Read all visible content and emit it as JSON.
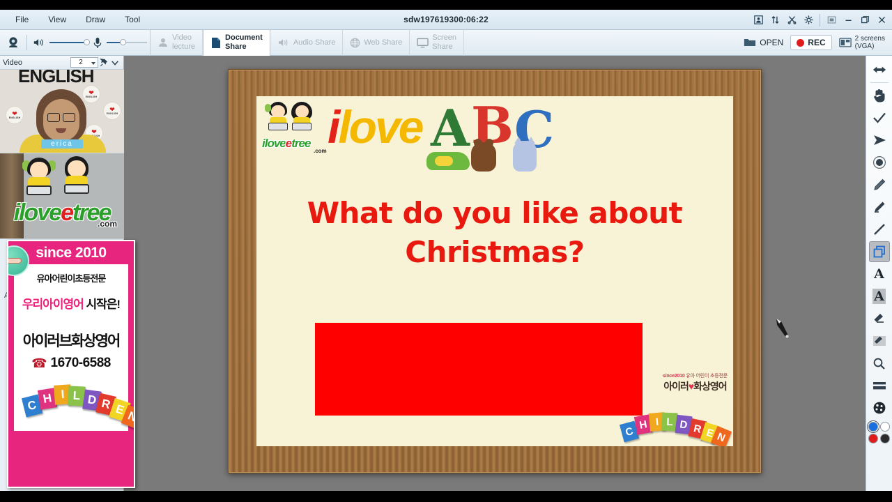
{
  "window": {
    "title": "sdw197619300:06:22",
    "menu": [
      "File",
      "View",
      "Draw",
      "Tool"
    ],
    "title_buttons": [
      {
        "name": "user-list-icon",
        "glyph": "☰"
      },
      {
        "name": "sort-arrows-icon",
        "glyph": "⇅"
      },
      {
        "name": "scissors-icon",
        "glyph": "✂"
      },
      {
        "name": "gear-icon",
        "glyph": "⚙"
      },
      {
        "name": "fullscreen-icon",
        "glyph": "▣"
      },
      {
        "name": "minimize-icon",
        "glyph": "–"
      },
      {
        "name": "maximize-icon",
        "glyph": "❐"
      },
      {
        "name": "close-icon",
        "glyph": "✕"
      }
    ]
  },
  "toolbar": {
    "speaker_level": 100,
    "mic_level": 40,
    "tabs": [
      {
        "label_line1": "Video",
        "label_line2": "lecture",
        "active": false,
        "icon": "person-video-icon"
      },
      {
        "label_line1": "Document",
        "label_line2": "Share",
        "active": true,
        "icon": "document-icon"
      },
      {
        "label_line1": "Audio Share",
        "label_line2": "",
        "active": false,
        "icon": "speaker-icon"
      },
      {
        "label_line1": "Web Share",
        "label_line2": "",
        "active": false,
        "icon": "globe-icon"
      },
      {
        "label_line1": "Screen",
        "label_line2": "Share",
        "active": false,
        "icon": "monitor-icon"
      }
    ],
    "open_label": "OPEN",
    "rec_label": "REC",
    "screens_line1": "2 screens",
    "screens_line2": "(VGA)"
  },
  "sidebar": {
    "panel_title": "Video",
    "video_count": "2",
    "agenda_label": "Agenda List",
    "videos": [
      {
        "name": "erica",
        "banner_text": "ENGLISH",
        "badge_text": "I LOVE ENGLISH"
      },
      {
        "logo_main": "ilove",
        "logo_e": "e",
        "logo_tail": "tree",
        "logo_dotcom": ".com"
      }
    ]
  },
  "ad": {
    "since": "since 2010",
    "line1": "유아어린이초등전문",
    "line2_pink": "우리아이영어",
    "line2_black": "시작은!",
    "brand": "아이러브화상영어",
    "phone": "1670-6588",
    "children": "CHILDREN"
  },
  "slide": {
    "logo_small_main": "ilove",
    "logo_small_e": "e",
    "logo_small_tail": "tree",
    "logo_small_dotcom": ".com",
    "ilove_i": "i",
    "ilove_rest": "love",
    "abc": [
      "A",
      "B",
      "C"
    ],
    "question_line1": "What do you like about",
    "question_line2": "Christmas?",
    "question_color": "#e8190f",
    "red_box_color": "#fe0000",
    "footer_since": "since2010",
    "footer_tagline": "유아 어린이 초등전문",
    "footer_brand_a": "아이러",
    "footer_brand_heart": "♥",
    "footer_brand_b": "화상영어",
    "children": "CHILDREN"
  },
  "rail": {
    "tools": [
      {
        "name": "pan-arrows-icon",
        "glyph": "↔",
        "selected": false
      },
      {
        "name": "hand-icon",
        "glyph": "✋",
        "selected": false
      },
      {
        "name": "check-icon",
        "glyph": "✓",
        "selected": false
      },
      {
        "name": "pointer-arrow-icon",
        "glyph": "➤",
        "selected": false
      },
      {
        "name": "dot-icon",
        "glyph": "◉",
        "selected": false
      },
      {
        "name": "pencil-icon",
        "glyph": "✎",
        "selected": false
      },
      {
        "name": "marker-icon",
        "glyph": "✒",
        "selected": false
      },
      {
        "name": "line-icon",
        "glyph": "╱",
        "selected": false
      },
      {
        "name": "shape-icon",
        "glyph": "⧉",
        "selected": true
      },
      {
        "name": "text-tool-icon",
        "glyph": "A",
        "selected": false
      },
      {
        "name": "text-highlight-icon",
        "glyph": "A",
        "selected": false
      },
      {
        "name": "eraser-icon",
        "glyph": "▱",
        "selected": false
      },
      {
        "name": "eraser-all-icon",
        "glyph": "▱",
        "selected": false
      },
      {
        "name": "magnifier-icon",
        "glyph": "⚲",
        "selected": false
      },
      {
        "name": "thickness-icon",
        "glyph": "☰",
        "selected": false
      },
      {
        "name": "palette-icon",
        "glyph": "●",
        "selected": false
      }
    ],
    "colors": [
      {
        "name": "blue",
        "hex": "#1a6fe0",
        "selected": true
      },
      {
        "name": "white",
        "hex": "#ffffff",
        "selected": false
      },
      {
        "name": "red",
        "hex": "#e01b1b",
        "selected": false
      },
      {
        "name": "black",
        "hex": "#2b2b2b",
        "selected": false
      }
    ]
  }
}
